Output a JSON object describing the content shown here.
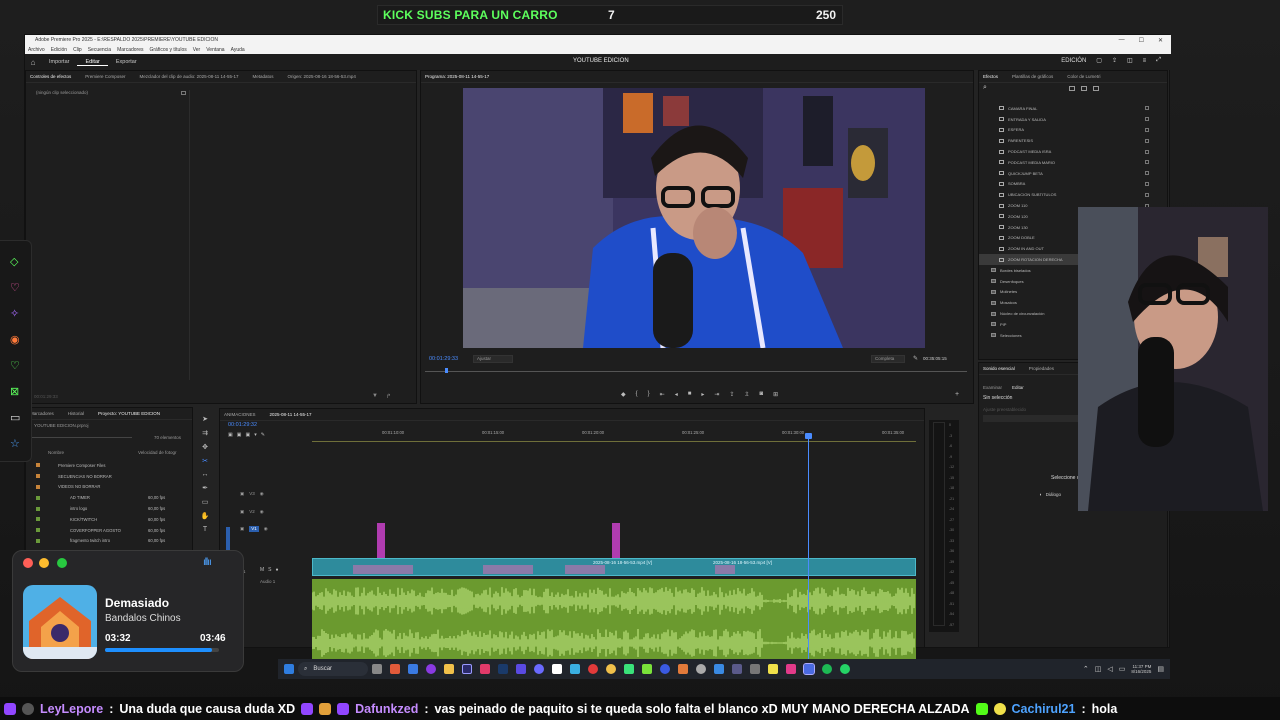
{
  "banner": {
    "title": "KICK SUBS PARA UN CARRO",
    "current": "7",
    "goal": "250"
  },
  "window": {
    "title": "Adobe Premiere Pro 2025 - E:\\RESPALDO 2025\\PREMIERE\\YOUTUBE EDICION",
    "menus": [
      "Archivo",
      "Edición",
      "Clip",
      "Secuencia",
      "Marcadores",
      "Gráficos y títulos",
      "Ver",
      "Ventana",
      "Ayuda"
    ],
    "nav": [
      "Importar",
      "Editar",
      "Exportar"
    ],
    "active_nav": "Editar",
    "center_title": "YOUTUBE EDICION",
    "workspace": "EDICIÓN"
  },
  "source_panel": {
    "tabs": [
      "Controles de efectos",
      "Premiere Composer",
      "Mezclador del clip de audio: 2025-08-11 14-55-17",
      "Metadatos",
      "Origen: 2025-08-16 18-56-53.mp4"
    ],
    "empty": "(ningún clip seleccionado)",
    "timecode": "00:01:29:33"
  },
  "program": {
    "tab": "Programa: 2025-08-11 14-55-17",
    "timecode": "00:01:29:33",
    "fit": "Ajustar",
    "quality": "Completa",
    "duration": "00:35:05:15"
  },
  "project": {
    "tabs": [
      "Marcadores",
      "Historial",
      "Proyecto: YOUTUBE EDICION"
    ],
    "file": "YOUTUBE EDICION.prproj",
    "count": "70 elementos",
    "col_name": "Nombre",
    "col_rate": "Velocidad de fotogr",
    "items": [
      {
        "name": "Premiere Composer Files",
        "rate": ""
      },
      {
        "name": "SECUENCIAS NO BORRAR",
        "rate": ""
      },
      {
        "name": "VIDEOS NO BORRAR",
        "rate": ""
      },
      {
        "name": "AD TIMER",
        "rate": "60,00 fps"
      },
      {
        "name": "intro logo",
        "rate": "60,00 fps"
      },
      {
        "name": "KICK/TWITCH",
        "rate": "60,00 fps"
      },
      {
        "name": "COVERFOPPER AGOSTO",
        "rate": "60,00 fps"
      },
      {
        "name": "fragmento twitch intro",
        "rate": "60,00 fps"
      }
    ]
  },
  "timeline": {
    "tabs": [
      "ANIMACIONES",
      "2025-08-11 14-55-17"
    ],
    "timecode": "00:01:29:32",
    "ruler": [
      "00:01:10:00",
      "00:01:15:00",
      "00:01:20:00",
      "00:01:25:00",
      "00:01:30:00",
      "00:01:35:00"
    ],
    "tracks": [
      "V3",
      "V2",
      "V1",
      "A1"
    ],
    "audio_label": "Audio 1",
    "clip_labels": [
      "2025-08-16 18-56-53.mp4 [V]",
      "2025-08-16 18-56-53.mp4 [V]"
    ]
  },
  "effects": {
    "tabs": [
      "Efectos",
      "Plantillas de gráficos",
      "Color de Lumetri"
    ],
    "items": [
      {
        "name": "CAMARA FINAL",
        "folder": false
      },
      {
        "name": "ENTRADA Y SALIDA",
        "folder": false
      },
      {
        "name": "ESFERA",
        "folder": false
      },
      {
        "name": "PARENTESIS",
        "folder": false
      },
      {
        "name": "PODCAST MEDIA ISRA",
        "folder": false
      },
      {
        "name": "PODCAST MEDIA MARIO",
        "folder": false
      },
      {
        "name": "QUICKJUMP BETA",
        "folder": false
      },
      {
        "name": "SOMBRA",
        "folder": false
      },
      {
        "name": "UBICACION SUBTITULOS",
        "folder": false
      },
      {
        "name": "ZOOM 110",
        "folder": false
      },
      {
        "name": "ZOOM 120",
        "folder": false
      },
      {
        "name": "ZOOM 130",
        "folder": false
      },
      {
        "name": "ZOOM DOBLE",
        "folder": false
      },
      {
        "name": "ZOOM IN AND OUT",
        "folder": false
      },
      {
        "name": "ZOOM ROTACION DERECHA",
        "folder": false
      },
      {
        "name": "Bordes biselados",
        "folder": true
      },
      {
        "name": "Desenfoques",
        "folder": true
      },
      {
        "name": "Molinetes",
        "folder": true
      },
      {
        "name": "Mosaicos",
        "folder": true
      },
      {
        "name": "Núcleo de circunvalación",
        "folder": true
      },
      {
        "name": "PIP",
        "folder": true
      },
      {
        "name": "Selecciones",
        "folder": true
      }
    ],
    "selected": "ZOOM ROTACION DERECHA"
  },
  "essential_sound": {
    "tabs": [
      "Sonido esencial",
      "Propiedades"
    ],
    "subtabs": [
      "Examinar",
      "Editar"
    ],
    "status": "Sin selección",
    "preset": "Ajuste preestablecido",
    "select_prompt": "Seleccione clips",
    "dialog": "Diálogo",
    "music": "Música",
    "ambience": "Ambiente"
  },
  "music": {
    "title": "Demasiado",
    "artist": "Bandalos Chinos",
    "elapsed": "03:32",
    "total": "03:46",
    "progress": 0.94
  },
  "taskbar": {
    "search": "Buscar",
    "time": "11:37 PM",
    "date": "8/16/2025"
  },
  "ticker": [
    {
      "user": "LeyLepore",
      "msg": "Una duda que causa duda XD"
    },
    {
      "user": "Dafunkzed",
      "msg": "vas peinado de paquito  si te queda  solo falta el blanco xD  MUY MANO DERECHA ALZADA"
    },
    {
      "user": "Cachirul21",
      "msg": "hola"
    }
  ],
  "colors": {
    "accent": "#4a8cff",
    "audio": "#6b9a2f",
    "clip": "#2e8b9c",
    "kick": "#5dff5d"
  }
}
